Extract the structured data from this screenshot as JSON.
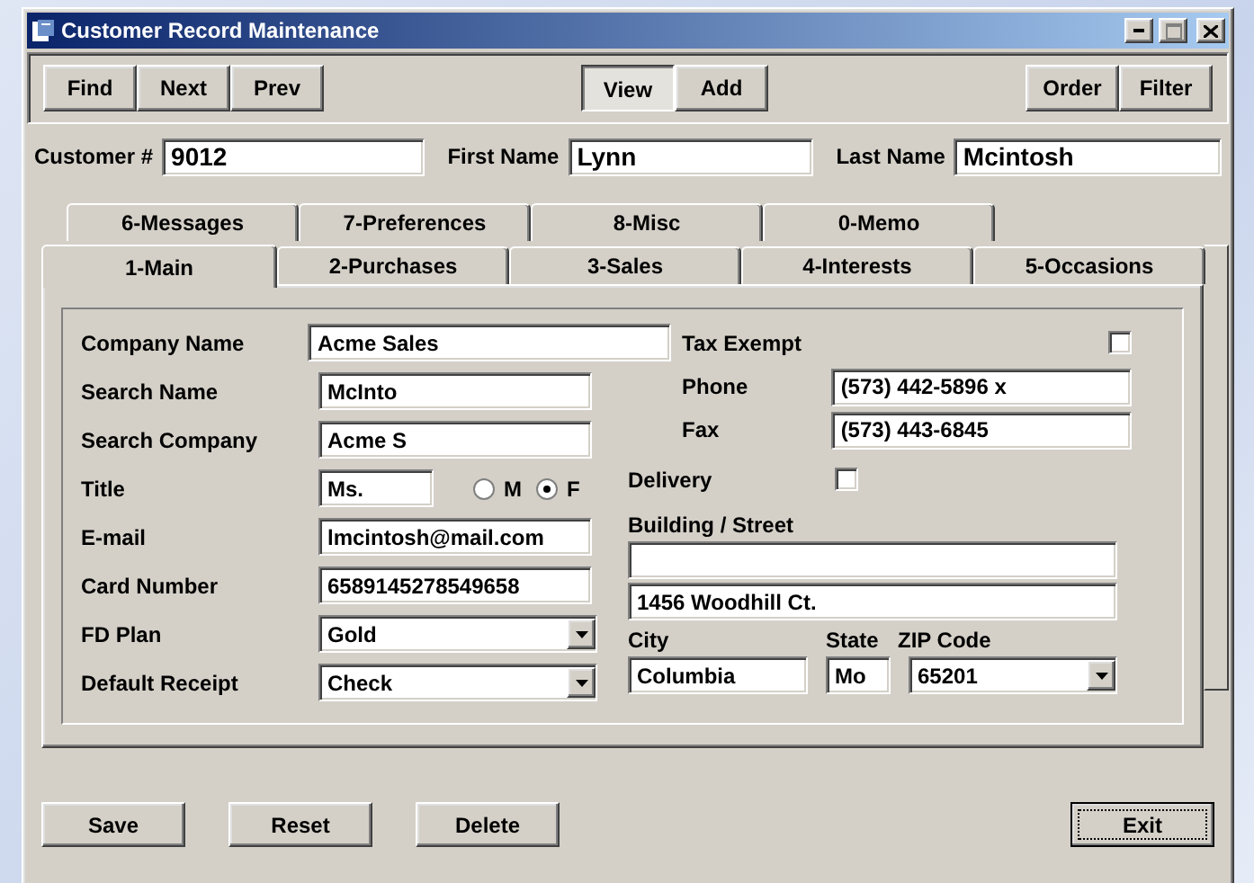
{
  "window": {
    "title": "Customer Record Maintenance"
  },
  "toolbar": [
    {
      "buttons": [
        {
          "label": "Find",
          "pressed": false
        },
        {
          "label": "Next",
          "pressed": false
        },
        {
          "label": "Prev",
          "pressed": false
        }
      ]
    },
    {
      "buttons": [
        {
          "label": "View",
          "pressed": true
        },
        {
          "label": "Add",
          "pressed": false
        }
      ]
    },
    {
      "buttons": [
        {
          "label": "Order",
          "pressed": false
        },
        {
          "label": "Filter",
          "pressed": false
        }
      ]
    }
  ],
  "header_fields": [
    {
      "label": "Customer #",
      "value": "9012"
    },
    {
      "label": "First Name",
      "value": "Lynn"
    },
    {
      "label": "Last Name",
      "value": "Mcintosh"
    }
  ],
  "tab_rows": [
    [
      {
        "label": "6-Messages",
        "selected": false
      },
      {
        "label": "7-Preferences",
        "selected": false
      },
      {
        "label": "8-Misc",
        "selected": false
      },
      {
        "label": "0-Memo",
        "selected": false
      }
    ],
    [
      {
        "label": "1-Main",
        "selected": true
      },
      {
        "label": "2-Purchases",
        "selected": false
      },
      {
        "label": "3-Sales",
        "selected": false
      },
      {
        "label": "4-Interests",
        "selected": false
      },
      {
        "label": "5-Occasions",
        "selected": false
      }
    ]
  ],
  "left_fields": [
    {
      "kind": "wide",
      "label": "Company Name",
      "value": "Acme Sales"
    },
    {
      "kind": "text",
      "label": "Search Name",
      "value": "McInto"
    },
    {
      "kind": "text",
      "label": "Search Company",
      "value": "Acme S"
    },
    {
      "kind": "title",
      "label": "Title",
      "value": "Ms.",
      "options": [
        {
          "label": "M",
          "selected": false
        },
        {
          "label": "F",
          "selected": true
        }
      ]
    },
    {
      "kind": "text",
      "label": "E-mail",
      "value": "lmcintosh@mail.com"
    },
    {
      "kind": "text",
      "label": "Card Number",
      "value": "6589145278549658"
    },
    {
      "kind": "select",
      "label": "FD Plan",
      "value": "Gold"
    },
    {
      "kind": "select",
      "label": "Default Receipt",
      "value": "Check"
    }
  ],
  "tax_exempt": {
    "label": "Tax Exempt",
    "checked": false
  },
  "phone": {
    "label": "Phone",
    "value": "(573) 442-5896 x"
  },
  "fax": {
    "label": "Fax",
    "value": "(573) 443-6845"
  },
  "delivery": {
    "label": "Delivery",
    "checked": false
  },
  "address": {
    "label": "Building / Street",
    "line_2": "1456 Woodhill Ct."
  },
  "city": {
    "label": "City",
    "value": "Columbia"
  },
  "state": {
    "label": "State",
    "value": "Mo"
  },
  "zip": {
    "label": "ZIP Code",
    "value": "65201"
  },
  "bottom_buttons": [
    {
      "label": "Save",
      "default": false
    },
    {
      "label": "Reset",
      "default": false
    },
    {
      "label": "Delete",
      "default": false
    },
    {
      "label": "Exit",
      "default": true
    }
  ]
}
